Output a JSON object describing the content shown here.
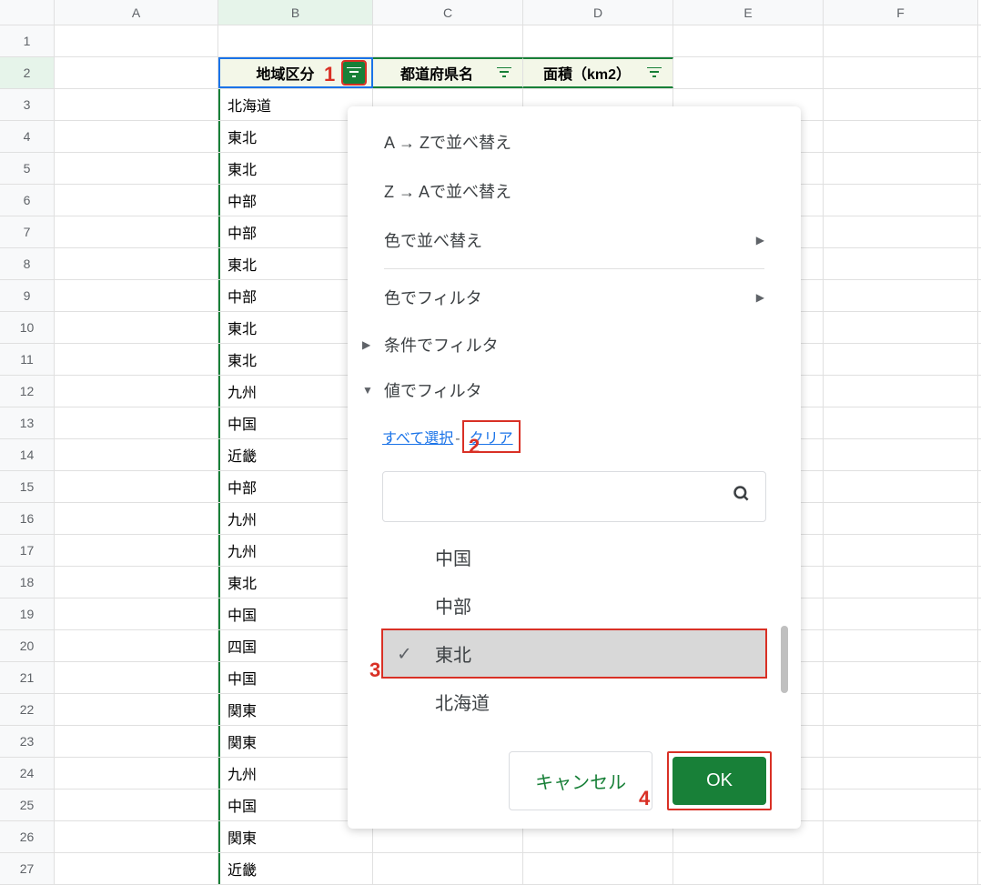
{
  "columns": [
    "A",
    "B",
    "C",
    "D",
    "E",
    "F"
  ],
  "rows": [
    1,
    2,
    3,
    4,
    5,
    6,
    7,
    8,
    9,
    10,
    11,
    12,
    13,
    14,
    15,
    16,
    17,
    18,
    19,
    20,
    21,
    22,
    23,
    24,
    25,
    26,
    27
  ],
  "headers": {
    "b": "地域区分",
    "c": "都道府県名",
    "d": "面積（km2）"
  },
  "data_b": [
    "北海道",
    "東北",
    "東北",
    "中部",
    "中部",
    "東北",
    "中部",
    "東北",
    "東北",
    "九州",
    "中国",
    "近畿",
    "中部",
    "九州",
    "九州",
    "東北",
    "中国",
    "四国",
    "中国",
    "関東",
    "関東",
    "九州",
    "中国",
    "関東",
    "近畿"
  ],
  "menu": {
    "sort_az": "A → Zで並べ替え",
    "sort_za": "Z → Aで並べ替え",
    "sort_color": "色で並べ替え",
    "filter_color": "色でフィルタ",
    "filter_condition": "条件でフィルタ",
    "filter_value": "値でフィルタ",
    "select_all": "すべて選択",
    "clear": "クリア",
    "search_placeholder": "",
    "values": [
      "中国",
      "中部",
      "東北",
      "北海道"
    ],
    "selected_value_index": 2,
    "cancel": "キャンセル",
    "ok": "OK"
  },
  "annotations": {
    "a1": "1",
    "a2": "2",
    "a3": "3",
    "a4": "4"
  }
}
